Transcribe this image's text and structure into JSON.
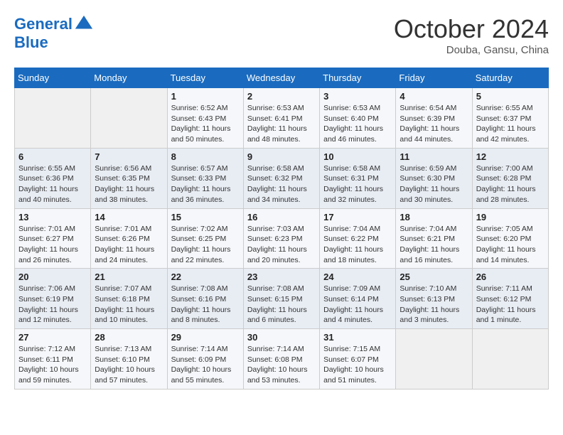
{
  "header": {
    "logo_line1": "General",
    "logo_line2": "Blue",
    "month": "October 2024",
    "location": "Douba, Gansu, China"
  },
  "weekdays": [
    "Sunday",
    "Monday",
    "Tuesday",
    "Wednesday",
    "Thursday",
    "Friday",
    "Saturday"
  ],
  "weeks": [
    [
      {
        "day": "",
        "info": ""
      },
      {
        "day": "",
        "info": ""
      },
      {
        "day": "1",
        "info": "Sunrise: 6:52 AM\nSunset: 6:43 PM\nDaylight: 11 hours and 50 minutes."
      },
      {
        "day": "2",
        "info": "Sunrise: 6:53 AM\nSunset: 6:41 PM\nDaylight: 11 hours and 48 minutes."
      },
      {
        "day": "3",
        "info": "Sunrise: 6:53 AM\nSunset: 6:40 PM\nDaylight: 11 hours and 46 minutes."
      },
      {
        "day": "4",
        "info": "Sunrise: 6:54 AM\nSunset: 6:39 PM\nDaylight: 11 hours and 44 minutes."
      },
      {
        "day": "5",
        "info": "Sunrise: 6:55 AM\nSunset: 6:37 PM\nDaylight: 11 hours and 42 minutes."
      }
    ],
    [
      {
        "day": "6",
        "info": "Sunrise: 6:55 AM\nSunset: 6:36 PM\nDaylight: 11 hours and 40 minutes."
      },
      {
        "day": "7",
        "info": "Sunrise: 6:56 AM\nSunset: 6:35 PM\nDaylight: 11 hours and 38 minutes."
      },
      {
        "day": "8",
        "info": "Sunrise: 6:57 AM\nSunset: 6:33 PM\nDaylight: 11 hours and 36 minutes."
      },
      {
        "day": "9",
        "info": "Sunrise: 6:58 AM\nSunset: 6:32 PM\nDaylight: 11 hours and 34 minutes."
      },
      {
        "day": "10",
        "info": "Sunrise: 6:58 AM\nSunset: 6:31 PM\nDaylight: 11 hours and 32 minutes."
      },
      {
        "day": "11",
        "info": "Sunrise: 6:59 AM\nSunset: 6:30 PM\nDaylight: 11 hours and 30 minutes."
      },
      {
        "day": "12",
        "info": "Sunrise: 7:00 AM\nSunset: 6:28 PM\nDaylight: 11 hours and 28 minutes."
      }
    ],
    [
      {
        "day": "13",
        "info": "Sunrise: 7:01 AM\nSunset: 6:27 PM\nDaylight: 11 hours and 26 minutes."
      },
      {
        "day": "14",
        "info": "Sunrise: 7:01 AM\nSunset: 6:26 PM\nDaylight: 11 hours and 24 minutes."
      },
      {
        "day": "15",
        "info": "Sunrise: 7:02 AM\nSunset: 6:25 PM\nDaylight: 11 hours and 22 minutes."
      },
      {
        "day": "16",
        "info": "Sunrise: 7:03 AM\nSunset: 6:23 PM\nDaylight: 11 hours and 20 minutes."
      },
      {
        "day": "17",
        "info": "Sunrise: 7:04 AM\nSunset: 6:22 PM\nDaylight: 11 hours and 18 minutes."
      },
      {
        "day": "18",
        "info": "Sunrise: 7:04 AM\nSunset: 6:21 PM\nDaylight: 11 hours and 16 minutes."
      },
      {
        "day": "19",
        "info": "Sunrise: 7:05 AM\nSunset: 6:20 PM\nDaylight: 11 hours and 14 minutes."
      }
    ],
    [
      {
        "day": "20",
        "info": "Sunrise: 7:06 AM\nSunset: 6:19 PM\nDaylight: 11 hours and 12 minutes."
      },
      {
        "day": "21",
        "info": "Sunrise: 7:07 AM\nSunset: 6:18 PM\nDaylight: 11 hours and 10 minutes."
      },
      {
        "day": "22",
        "info": "Sunrise: 7:08 AM\nSunset: 6:16 PM\nDaylight: 11 hours and 8 minutes."
      },
      {
        "day": "23",
        "info": "Sunrise: 7:08 AM\nSunset: 6:15 PM\nDaylight: 11 hours and 6 minutes."
      },
      {
        "day": "24",
        "info": "Sunrise: 7:09 AM\nSunset: 6:14 PM\nDaylight: 11 hours and 4 minutes."
      },
      {
        "day": "25",
        "info": "Sunrise: 7:10 AM\nSunset: 6:13 PM\nDaylight: 11 hours and 3 minutes."
      },
      {
        "day": "26",
        "info": "Sunrise: 7:11 AM\nSunset: 6:12 PM\nDaylight: 11 hours and 1 minute."
      }
    ],
    [
      {
        "day": "27",
        "info": "Sunrise: 7:12 AM\nSunset: 6:11 PM\nDaylight: 10 hours and 59 minutes."
      },
      {
        "day": "28",
        "info": "Sunrise: 7:13 AM\nSunset: 6:10 PM\nDaylight: 10 hours and 57 minutes."
      },
      {
        "day": "29",
        "info": "Sunrise: 7:14 AM\nSunset: 6:09 PM\nDaylight: 10 hours and 55 minutes."
      },
      {
        "day": "30",
        "info": "Sunrise: 7:14 AM\nSunset: 6:08 PM\nDaylight: 10 hours and 53 minutes."
      },
      {
        "day": "31",
        "info": "Sunrise: 7:15 AM\nSunset: 6:07 PM\nDaylight: 10 hours and 51 minutes."
      },
      {
        "day": "",
        "info": ""
      },
      {
        "day": "",
        "info": ""
      }
    ]
  ]
}
